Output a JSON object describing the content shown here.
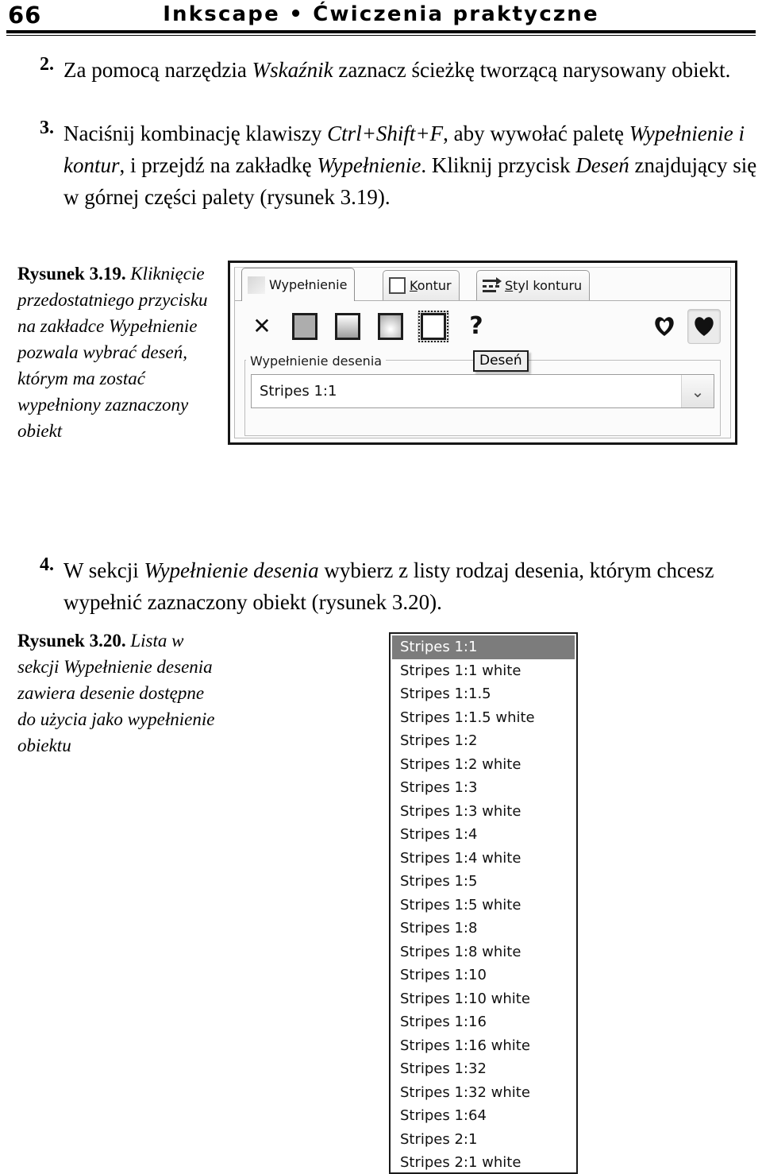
{
  "header": {
    "folio": "66",
    "running_head": "Inkscape • Ćwiczenia praktyczne"
  },
  "steps": [
    {
      "number": "2.",
      "text_runs": [
        {
          "t": "Za pomocą narzędzia ",
          "i": false
        },
        {
          "t": "Wskaźnik",
          "i": true
        },
        {
          "t": " zaznacz ścieżkę tworzącą narysowany obiekt.",
          "i": false
        }
      ]
    },
    {
      "number": "3.",
      "text_runs": [
        {
          "t": "Naciśnij kombinację klawiszy ",
          "i": false
        },
        {
          "t": "Ctrl+Shift+F",
          "i": true
        },
        {
          "t": ", aby wywołać paletę ",
          "i": false
        },
        {
          "t": "Wypełnienie i kontur",
          "i": true
        },
        {
          "t": ", i przejdź na zakładkę ",
          "i": false
        },
        {
          "t": "Wypełnienie",
          "i": true
        },
        {
          "t": ". Kliknij przycisk ",
          "i": false
        },
        {
          "t": "Deseń",
          "i": true
        },
        {
          "t": " znajdujący się w górnej części palety (rysunek 3.19).",
          "i": false
        }
      ]
    },
    {
      "number": "4.",
      "text_runs": [
        {
          "t": "W sekcji ",
          "i": false
        },
        {
          "t": "Wypełnienie desenia",
          "i": true
        },
        {
          "t": " wybierz z listy rodzaj desenia, którym chcesz wypełnić zaznaczony obiekt (rysunek 3.20).",
          "i": false
        }
      ]
    }
  ],
  "captions": {
    "fig319": {
      "label": "Rysunek 3.19.",
      "text": "Kliknięcie przedostatniego przycisku na zakładce Wypełnienie pozwala wybrać deseń, którym ma zostać wypełniony zaznaczony obiekt"
    },
    "fig320": {
      "label": "Rysunek 3.20.",
      "text": "Lista w sekcji Wypełnienie desenia zawiera desenie dostępne do użycia jako wypełnienie obiektu"
    }
  },
  "dialog": {
    "tabs": [
      {
        "label": "Wypełnienie",
        "mnemonic": "",
        "icon": "fill-swatch-icon",
        "active": true
      },
      {
        "label": "ontur",
        "mnemonic": "K",
        "icon": "stroke-swatch-icon",
        "active": false
      },
      {
        "label": "tyl konturu",
        "mnemonic": "S",
        "icon": "stroke-style-icon",
        "active": false
      }
    ],
    "fill_type_buttons": [
      {
        "name": "no-paint-button",
        "glyph": "✕",
        "pressed": false
      },
      {
        "name": "flat-color-button",
        "glyph": "",
        "pressed": false
      },
      {
        "name": "linear-gradient-button",
        "glyph": "",
        "pressed": false
      },
      {
        "name": "radial-gradient-button",
        "glyph": "",
        "pressed": false
      },
      {
        "name": "pattern-button",
        "glyph": "",
        "pressed": true
      },
      {
        "name": "unknown-paint-button",
        "glyph": "?",
        "pressed": false
      }
    ],
    "fill_rule_buttons": [
      {
        "name": "even-odd-fill-rule-button",
        "pressed": false
      },
      {
        "name": "nonzero-fill-rule-button",
        "pressed": true
      }
    ],
    "group_label": "Wypełnienie desenia",
    "tooltip": "Deseń",
    "pattern_combo_value": "Stripes 1:1",
    "combo_arrow_glyph": "⌄"
  },
  "dropdown": {
    "items": [
      {
        "label": "Stripes 1:1",
        "selected": true
      },
      {
        "label": "Stripes 1:1 white",
        "selected": false
      },
      {
        "label": "Stripes 1:1.5",
        "selected": false
      },
      {
        "label": "Stripes 1:1.5 white",
        "selected": false
      },
      {
        "label": "Stripes 1:2",
        "selected": false
      },
      {
        "label": "Stripes 1:2 white",
        "selected": false
      },
      {
        "label": "Stripes 1:3",
        "selected": false
      },
      {
        "label": "Stripes 1:3 white",
        "selected": false
      },
      {
        "label": "Stripes 1:4",
        "selected": false
      },
      {
        "label": "Stripes 1:4 white",
        "selected": false
      },
      {
        "label": "Stripes 1:5",
        "selected": false
      },
      {
        "label": "Stripes 1:5 white",
        "selected": false
      },
      {
        "label": "Stripes 1:8",
        "selected": false
      },
      {
        "label": "Stripes 1:8 white",
        "selected": false
      },
      {
        "label": "Stripes 1:10",
        "selected": false
      },
      {
        "label": "Stripes 1:10 white",
        "selected": false
      },
      {
        "label": "Stripes 1:16",
        "selected": false
      },
      {
        "label": "Stripes 1:16 white",
        "selected": false
      },
      {
        "label": "Stripes 1:32",
        "selected": false
      },
      {
        "label": "Stripes 1:32 white",
        "selected": false
      },
      {
        "label": "Stripes 1:64",
        "selected": false
      },
      {
        "label": "Stripes 2:1",
        "selected": false
      },
      {
        "label": "Stripes 2:1 white",
        "selected": false
      }
    ]
  },
  "colors": {
    "page_background": "#ffffff",
    "text": "#000000",
    "dialog_border": "#161616",
    "dialog_background": "#fbfbfb",
    "selection_highlight": "#7c7c7c",
    "selection_text": "#ffffff"
  }
}
